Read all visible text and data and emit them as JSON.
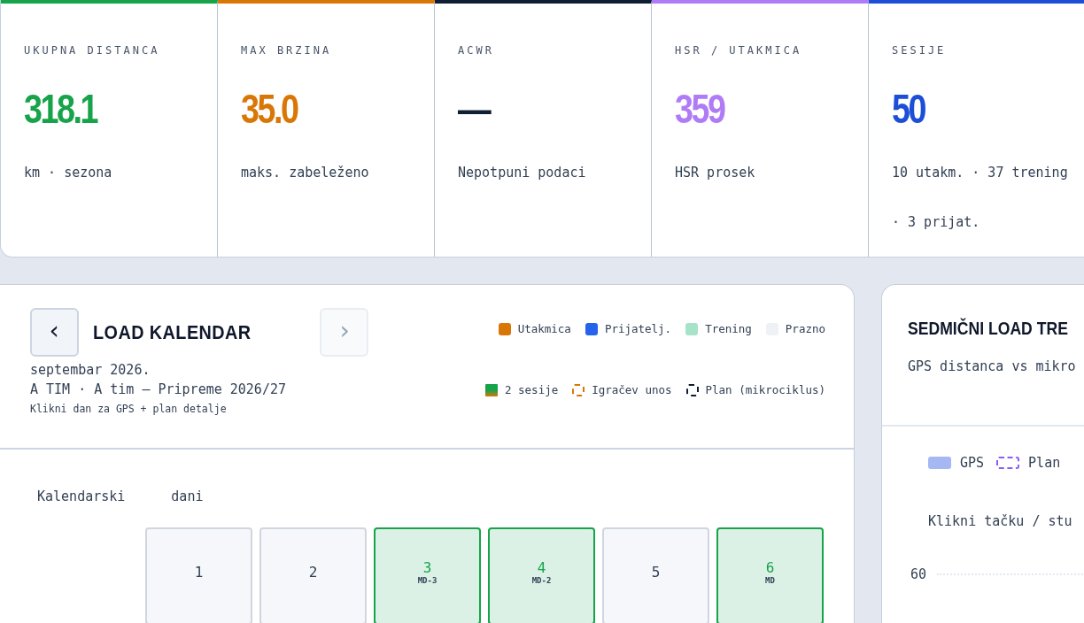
{
  "stats": [
    {
      "label": "UKUPNA DISTANCA",
      "value": "318.1",
      "sub": "km · sezona",
      "color": "#16a34a"
    },
    {
      "label": "MAX BRZINA",
      "value": "35.0",
      "sub": "maks. zabeleženo",
      "color": "#d97706"
    },
    {
      "label": "ACWR",
      "value": "—",
      "sub": "Nepotpuni podaci",
      "color": "#0f1e33"
    },
    {
      "label": "HSR / UTAKMICA",
      "value": "359",
      "sub": "HSR prosek",
      "color": "#b07cf5"
    },
    {
      "label": "SESIJE",
      "value": "50",
      "sub": "10 utakm. · 37 trening · 3 prijat.",
      "color": "#1d4ed8"
    }
  ],
  "calendar": {
    "title": "LOAD KALENDAR",
    "prev": {
      "label": "‹",
      "disabled": false
    },
    "next": {
      "label": "›",
      "disabled": true
    },
    "month": "septembar 2026.",
    "team": "A TIM · A tim — Pripreme 2026/27",
    "hint": "Klikni dan za GPS + plan detalje",
    "legend": [
      {
        "kind": "solid",
        "label": "Utakmica",
        "color": "#d97706"
      },
      {
        "kind": "solid",
        "label": "Prijatelj.",
        "color": "#2563eb"
      },
      {
        "kind": "solid",
        "label": "Trening",
        "color": "#a7e3c9"
      },
      {
        "kind": "solid",
        "label": "Prazno",
        "color": "#eef2f7"
      },
      {
        "kind": "split",
        "label": "2 sesije",
        "color": "#16a34a"
      },
      {
        "kind": "dashed",
        "label": "Igračev unos",
        "color": "#d97706"
      },
      {
        "kind": "dashed",
        "label": "Plan (mikrociklus)",
        "color": "#0f1e33"
      }
    ],
    "heading": [
      "Kalendarski",
      "dani"
    ],
    "days": [
      {
        "day": "1",
        "kind": "empty"
      },
      {
        "day": "2",
        "kind": "empty"
      },
      {
        "day": "3",
        "kind": "training",
        "tag": "MD-3"
      },
      {
        "day": "4",
        "kind": "training",
        "tag": "MD-2"
      },
      {
        "day": "5",
        "kind": "empty"
      },
      {
        "day": "6",
        "kind": "training",
        "tag": "MD"
      }
    ]
  },
  "weekly": {
    "title": "SEDMIČNI LOAD TRE",
    "subtitle": "GPS distanca vs mikro",
    "legend": [
      {
        "kind": "solid",
        "label": "GPS",
        "color": "#a5b8f3"
      },
      {
        "kind": "dashed",
        "label": "Plan",
        "color": "#8b5cf6"
      }
    ],
    "hint": "Klikni tačku / stu",
    "ytick": "60"
  }
}
